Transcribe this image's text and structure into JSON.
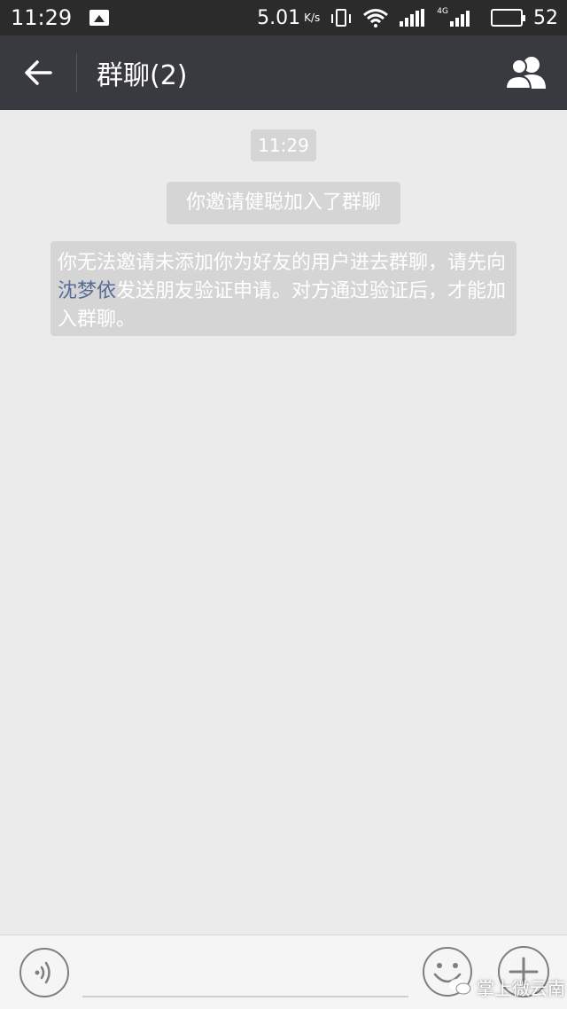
{
  "status_bar": {
    "time": "11:29",
    "net_speed": "5.01",
    "net_speed_unit": "K/s",
    "network_type": "4G",
    "battery": "52",
    "battery_level_percent": 52
  },
  "nav": {
    "title": "群聊(2)",
    "back_icon": "arrow-left-icon",
    "group_icon": "group-members-icon"
  },
  "chat": {
    "timestamp": "11:29",
    "system_messages": [
      {
        "text": "你邀请健聪加入了群聊"
      },
      {
        "text_before": "你无法邀请未添加你为好友的用户进去群聊，请先向",
        "name": "沈梦依",
        "text_after": "发送朋友验证申请。对方通过验证后，才能加入群聊。"
      }
    ]
  },
  "input_bar": {
    "voice_icon": "voice-icon",
    "input_value": "",
    "emoji_icon": "emoji-icon",
    "plus_icon": "plus-icon"
  },
  "watermark": {
    "text": "掌上微云南"
  },
  "colors": {
    "status_bar_bg": "#2b2b2b",
    "nav_bg": "#393a3f",
    "chat_bg": "#ebebeb",
    "system_bubble_bg": "#d5d5d5",
    "name_link": "#576b95"
  }
}
